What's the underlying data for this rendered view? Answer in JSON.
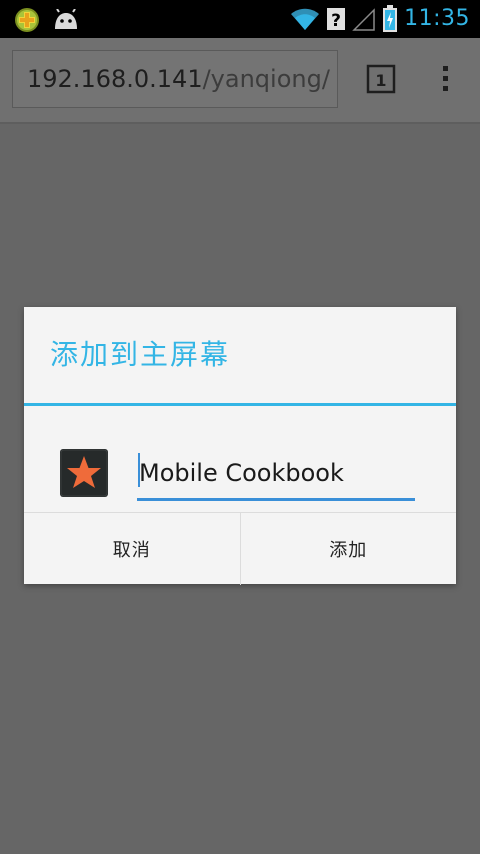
{
  "status_bar": {
    "time": "11:35",
    "icons": [
      "cross-app-notification-icon",
      "android-notification-icon",
      "wifi-icon",
      "unknown-signal-icon",
      "cell-signal-icon",
      "battery-charging-icon"
    ],
    "accent_color": "#33b5e5"
  },
  "browser": {
    "url_host": "192.168.0.141",
    "url_path": "/yanqiong/",
    "tab_count": "1"
  },
  "dialog": {
    "title": "添加到主屏幕",
    "shortcut_name": "Mobile Cookbook",
    "app_icon": "star-app-icon",
    "cancel_label": "取消",
    "add_label": "添加",
    "accent_color": "#33b5e5"
  }
}
